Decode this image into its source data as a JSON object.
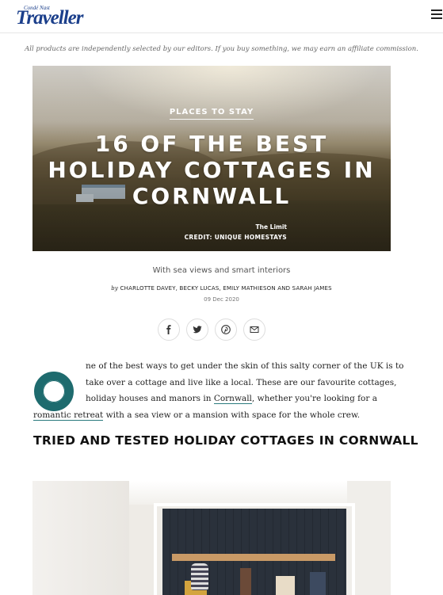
{
  "header": {
    "logo_small": "Condé Nast",
    "logo_main": "Traveller",
    "menu_icon": "hamburger-menu-icon"
  },
  "disclaimer": "All products are independently selected by our editors. If you buy something, we may earn an affiliate commission.",
  "hero": {
    "rubric": "PLACES TO STAY",
    "title": "16 of the best holiday cottages in Cornwall",
    "caption": "The Limit",
    "credit": "CREDIT: UNIQUE HOMESTAYS"
  },
  "article": {
    "subtitle": "With sea views and smart interiors",
    "by": "by",
    "authors": "CHARLOTTE DAVEY, BECKY LUCAS, EMILY MATHIESON AND SARAH JAMES",
    "date": "09 Dec 2020"
  },
  "share": [
    {
      "name": "facebook-icon"
    },
    {
      "name": "twitter-icon"
    },
    {
      "name": "pinterest-icon"
    },
    {
      "name": "email-icon"
    }
  ],
  "intro": {
    "line1": "ne of the best ways to get under the skin of this salty corner of the UK is to",
    "line2": "take over a cottage and live like a local. These are our favourite cottages,",
    "line3_pre": "holiday houses and manors in ",
    "link_cornwall": "Cornwall",
    "line3_post": ", whether you're looking for a",
    "link_retreat": "romantic retreat",
    "line4_post": " with a sea view or a mansion with space for the whole crew."
  },
  "section_title": "TRIED AND TESTED HOLIDAY COTTAGES IN CORNWALL",
  "colors": {
    "brand": "#1b3f8b",
    "accent": "#1e6b6e"
  }
}
